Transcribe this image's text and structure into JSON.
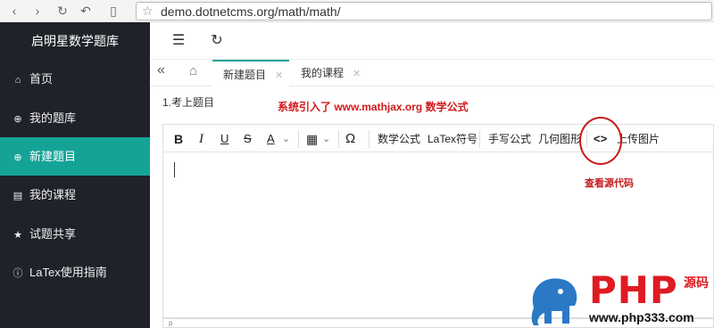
{
  "browser": {
    "url": "demo.dotnetcms.org/math/math/"
  },
  "sidebar": {
    "brand": "启明星数学题库",
    "items": [
      {
        "label": "首页",
        "icon": "home-icon",
        "active": false
      },
      {
        "label": "我的题库",
        "icon": "plus-circle-icon",
        "active": false
      },
      {
        "label": "新建题目",
        "icon": "plus-circle-icon",
        "active": true
      },
      {
        "label": "我的课程",
        "icon": "clipboard-icon",
        "active": false
      },
      {
        "label": "试题共享",
        "icon": "star-icon",
        "active": false
      },
      {
        "label": "LaTex使用指南",
        "icon": "info-icon",
        "active": false
      }
    ]
  },
  "tabs": [
    {
      "label": "新建题目",
      "active": true
    },
    {
      "label": "我的课程",
      "active": false
    }
  ],
  "form": {
    "question_label": "1.考上题目"
  },
  "toolbar": {
    "bold": "B",
    "italic": "I",
    "underline": "U",
    "strike": "S",
    "font_color": "A",
    "special_char": "Ω",
    "math_formula": "数学公式",
    "latex": "LaTex符号",
    "handwrite": "手写公式",
    "geometry": "几何图形",
    "source": "<>",
    "upload_image": "上传图片"
  },
  "editor": {
    "status": "p"
  },
  "annotations": {
    "mathjax_note": "系统引入了 www.mathjax.org 数学公式",
    "source_note": "查看源代码",
    "color": "#c81b1b"
  },
  "watermark": {
    "brand": "PHP",
    "code": "源码",
    "site": "www.php333.com"
  },
  "colors": {
    "accent": "#15a398",
    "sidebar_bg": "#20222a"
  }
}
